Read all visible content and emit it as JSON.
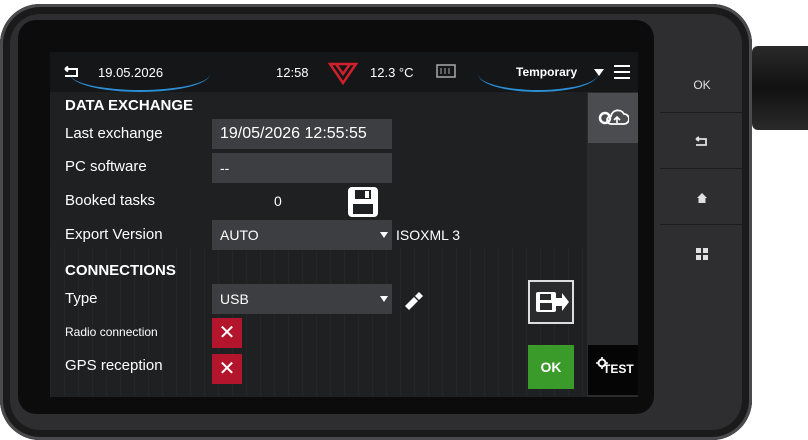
{
  "header": {
    "date": "19.05.2026",
    "time": "12:58",
    "temperature": "12.3 °C",
    "profile": "Temporary"
  },
  "data_exchange": {
    "title": "DATA EXCHANGE",
    "last_exchange_label": "Last exchange",
    "last_exchange_value": "19/05/2026 12:55:55",
    "pc_software_label": "PC software",
    "pc_software_value": "--",
    "booked_tasks_label": "Booked tasks",
    "booked_tasks_value": "0",
    "export_version_label": "Export Version",
    "export_version_value": "AUTO",
    "export_format": "ISOXML 3"
  },
  "connections": {
    "title": "CONNECTIONS",
    "type_label": "Type",
    "type_value": "USB",
    "radio_label": "Radio connection",
    "gps_label": "GPS reception"
  },
  "buttons": {
    "ok": "OK",
    "test": "TEST"
  },
  "hardware": {
    "ok": "OK"
  },
  "colors": {
    "accent_blue": "#2b8fd6",
    "alert_red": "#b3152d",
    "ok_green": "#3a9a2a",
    "brand_red": "#d0202c"
  }
}
